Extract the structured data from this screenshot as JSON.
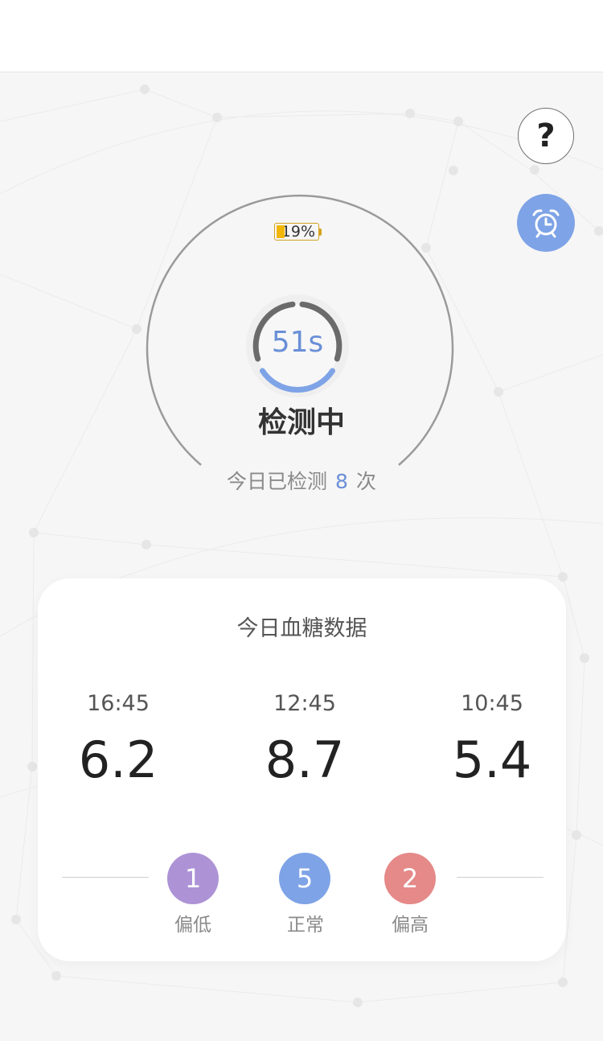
{
  "battery": {
    "percent": "19%",
    "level": 0.19
  },
  "timer": {
    "label": "51s",
    "progress": 0.35
  },
  "status": {
    "text": "检测中"
  },
  "today_count": {
    "prefix": "今日已检测",
    "count": "8",
    "suffix": "次"
  },
  "card": {
    "title": "今日血糖数据",
    "readings": [
      {
        "time": "16:45",
        "value": "6.2"
      },
      {
        "time": "12:45",
        "value": "8.7"
      },
      {
        "time": "10:45",
        "value": "5.4"
      }
    ],
    "summary": [
      {
        "count": "1",
        "label": "偏低",
        "color": "#ad93d6"
      },
      {
        "count": "5",
        "label": "正常",
        "color": "#7ea3e6"
      },
      {
        "count": "2",
        "label": "偏高",
        "color": "#e58989"
      }
    ]
  },
  "icons": {
    "help": "?",
    "alarm": "alarm-clock-icon"
  },
  "colors": {
    "accent": "#7ea3e6",
    "timer_text": "#6a8fd8",
    "battery": "#f2b705"
  }
}
